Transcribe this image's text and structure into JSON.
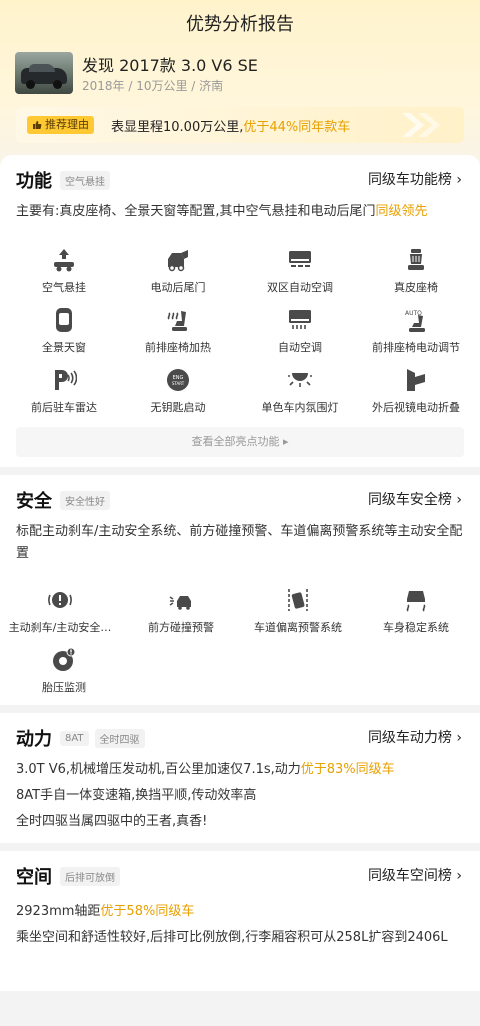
{
  "header": {
    "title": "优势分析报告"
  },
  "car": {
    "name": "发现 2017款 3.0 V6 SE",
    "meta": "2018年 / 10万公里 / 济南"
  },
  "reason": {
    "tag": "推荐理由",
    "text_prefix": "表显里程10.00万公里,",
    "text_highlight": "优于44%同年款车"
  },
  "function": {
    "title": "功能",
    "tag": "空气悬挂",
    "rank": "同级车功能榜 ›",
    "desc_prefix": "主要有:真皮座椅、全景天窗等配置,其中空气悬挂和电动后尾门",
    "desc_highlight": "同级领先",
    "features": [
      {
        "label": "空气悬挂",
        "icon": "air-suspension-icon"
      },
      {
        "label": "电动后尾门",
        "icon": "power-tailgate-icon"
      },
      {
        "label": "双区自动空调",
        "icon": "dual-zone-ac-icon"
      },
      {
        "label": "真皮座椅",
        "icon": "leather-seat-icon"
      },
      {
        "label": "全景天窗",
        "icon": "panoramic-sunroof-icon"
      },
      {
        "label": "前排座椅加热",
        "icon": "seat-heating-icon"
      },
      {
        "label": "自动空调",
        "icon": "auto-ac-icon"
      },
      {
        "label": "前排座椅电动调节",
        "icon": "power-seat-icon"
      },
      {
        "label": "前后驻车雷达",
        "icon": "parking-radar-icon"
      },
      {
        "label": "无钥匙启动",
        "icon": "keyless-start-icon"
      },
      {
        "label": "单色车内氛围灯",
        "icon": "ambient-light-icon"
      },
      {
        "label": "外后视镜电动折叠",
        "icon": "mirror-fold-icon"
      }
    ],
    "view_all": "查看全部亮点功能 ▸"
  },
  "safety": {
    "title": "安全",
    "tag": "安全性好",
    "rank": "同级车安全榜 ›",
    "desc": "标配主动刹车/主动安全系统、前方碰撞预警、车道偏离预警系统等主动安全配置",
    "features": [
      {
        "label": "主动刹车/主动安全…",
        "icon": "active-brake-icon"
      },
      {
        "label": "前方碰撞预警",
        "icon": "collision-warning-icon"
      },
      {
        "label": "车道偏离预警系统",
        "icon": "lane-departure-icon"
      },
      {
        "label": "车身稳定系统",
        "icon": "stability-control-icon"
      },
      {
        "label": "胎压监测",
        "icon": "tire-pressure-icon"
      }
    ]
  },
  "power": {
    "title": "动力",
    "tags": [
      "8AT",
      "全时四驱"
    ],
    "rank": "同级车动力榜 ›",
    "line1_prefix": "3.0T V6,机械增压发动机,百公里加速仅7.1s,动力",
    "line1_highlight": "优于83%同级车",
    "line2": "8AT手自一体变速箱,换挡平顺,传动效率高",
    "line3": "全时四驱当属四驱中的王者,真香!"
  },
  "space": {
    "title": "空间",
    "tag": "后排可放倒",
    "rank": "同级车空间榜 ›",
    "line1_prefix": "2923mm轴距",
    "line1_highlight": "优于58%同级车",
    "line2": "乘坐空间和舒适性较好,后排可比例放倒,行李厢容积可从258L扩容到2406L"
  },
  "colors": {
    "accent": "#e8a000",
    "tag_yellow": "#ffc933",
    "icon_gray": "#4a4a4a"
  }
}
